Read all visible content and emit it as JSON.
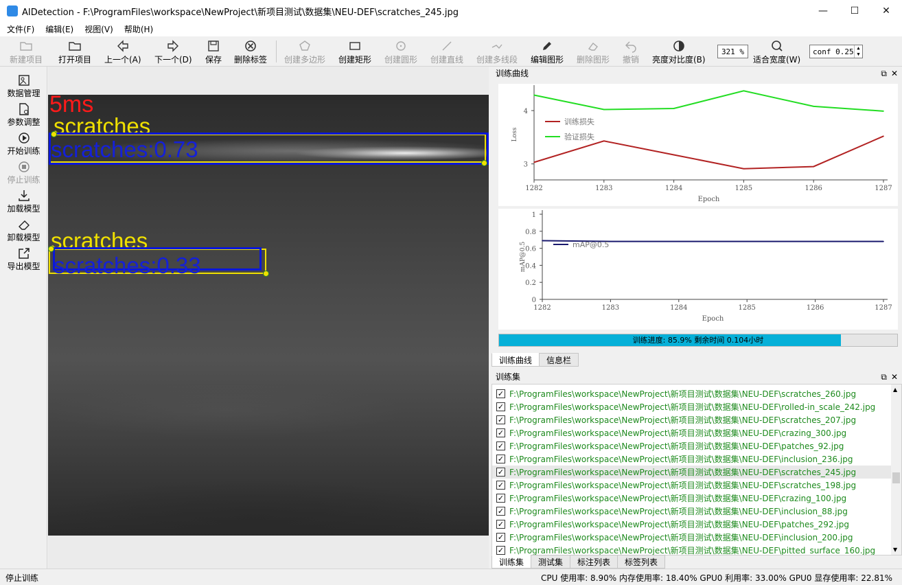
{
  "window": {
    "title": "AIDetection - F:\\ProgramFiles\\workspace\\NewProject\\新项目测试\\数据集\\NEU-DEF\\scratches_245.jpg",
    "minimize": "—",
    "maximize": "☐",
    "close": "✕"
  },
  "menu": [
    "文件(F)",
    "编辑(E)",
    "视图(V)",
    "帮助(H)"
  ],
  "toolbar": {
    "new_project": "新建项目",
    "open_project": "打开项目",
    "prev": "上一个(A)",
    "next": "下一个(D)",
    "save": "保存",
    "delete_label": "删除标签",
    "create_polygon": "创建多边形",
    "create_rect": "创建矩形",
    "create_circle": "创建圆形",
    "create_line": "创建直线",
    "create_polyline": "创建多线段",
    "edit_shape": "编辑图形",
    "delete_shape": "删除图形",
    "undo": "撤销",
    "brightness": "亮度对比度(B)",
    "zoom": "321 %",
    "fit_width": "适合宽度(W)",
    "conf": "conf 0.25"
  },
  "left_panel": {
    "data_mgmt": "数据管理",
    "params": "参数调整",
    "start_train": "开始训练",
    "stop_train": "停止训练",
    "load_model": "加载模型",
    "unload_model": "卸载模型",
    "export_model": "导出模型"
  },
  "canvas": {
    "time_label": "5ms",
    "detections": [
      {
        "label": "scratches",
        "score_label": "scratches:0.73"
      },
      {
        "label": "scratches",
        "score_label": "scratches:0.33"
      }
    ]
  },
  "curve_dock": {
    "title": "训练曲线",
    "float_icon": "⧉",
    "close_icon": "✕"
  },
  "chart_data": [
    {
      "type": "line",
      "x": [
        1282,
        1283,
        1284,
        1285,
        1286,
        1287
      ],
      "xlabel": "Epoch",
      "ylabel": "Loss",
      "x_ticks": [
        "1282",
        "1283",
        "1284",
        "1285",
        "1286",
        "1287"
      ],
      "y_ticks": [
        "3",
        "4"
      ],
      "ylim": [
        2.7,
        4.4
      ],
      "series": [
        {
          "name": "训练损失",
          "color": "#b22222",
          "values": [
            3.03,
            3.43,
            3.17,
            2.91,
            2.95,
            3.52
          ]
        },
        {
          "name": "验证损失",
          "color": "#22dd22",
          "values": [
            4.29,
            4.02,
            4.04,
            4.37,
            4.08,
            3.99
          ]
        }
      ],
      "legend": "top-left",
      "grid": false
    },
    {
      "type": "line",
      "x": [
        1282,
        1283,
        1284,
        1285,
        1286,
        1287
      ],
      "xlabel": "Epoch",
      "ylabel": "mAP@0.5",
      "x_ticks": [
        "1282",
        "1283",
        "1284",
        "1285",
        "1286",
        "1287"
      ],
      "y_ticks": [
        "0",
        "0.2",
        "0.4",
        "0.6",
        "0.8",
        "1"
      ],
      "ylim": [
        0,
        1
      ],
      "series": [
        {
          "name": "mAP@0.5",
          "color": "#1a1a6e",
          "values": [
            0.69,
            0.68,
            0.68,
            0.68,
            0.68,
            0.68
          ]
        }
      ],
      "legend": "top-left",
      "grid": false
    }
  ],
  "progress": {
    "text": "训练进度: 85.9% 剩余时间 0.104小时",
    "fraction": 0.859
  },
  "curve_tabs": [
    "训练曲线",
    "信息栏"
  ],
  "train_dock": {
    "title": "训练集",
    "float_icon": "⧉",
    "close_icon": "✕",
    "files": [
      "F:\\ProgramFiles\\workspace\\NewProject\\新项目测试\\数据集\\NEU-DEF\\scratches_260.jpg",
      "F:\\ProgramFiles\\workspace\\NewProject\\新项目测试\\数据集\\NEU-DEF\\rolled-in_scale_242.jpg",
      "F:\\ProgramFiles\\workspace\\NewProject\\新项目测试\\数据集\\NEU-DEF\\scratches_207.jpg",
      "F:\\ProgramFiles\\workspace\\NewProject\\新项目测试\\数据集\\NEU-DEF\\crazing_300.jpg",
      "F:\\ProgramFiles\\workspace\\NewProject\\新项目测试\\数据集\\NEU-DEF\\patches_92.jpg",
      "F:\\ProgramFiles\\workspace\\NewProject\\新项目测试\\数据集\\NEU-DEF\\inclusion_236.jpg",
      "F:\\ProgramFiles\\workspace\\NewProject\\新项目测试\\数据集\\NEU-DEF\\scratches_245.jpg",
      "F:\\ProgramFiles\\workspace\\NewProject\\新项目测试\\数据集\\NEU-DEF\\scratches_198.jpg",
      "F:\\ProgramFiles\\workspace\\NewProject\\新项目测试\\数据集\\NEU-DEF\\crazing_100.jpg",
      "F:\\ProgramFiles\\workspace\\NewProject\\新项目测试\\数据集\\NEU-DEF\\inclusion_88.jpg",
      "F:\\ProgramFiles\\workspace\\NewProject\\新项目测试\\数据集\\NEU-DEF\\patches_292.jpg",
      "F:\\ProgramFiles\\workspace\\NewProject\\新项目测试\\数据集\\NEU-DEF\\inclusion_200.jpg",
      "F:\\ProgramFiles\\workspace\\NewProject\\新项目测试\\数据集\\NEU-DEF\\pitted_surface_160.jpg"
    ],
    "selected_index": 6
  },
  "list_tabs": [
    "训练集",
    "测试集",
    "标注列表",
    "标签列表"
  ],
  "status": {
    "left": "停止训练",
    "right": "CPU 使用率: 8.90% 内存使用率: 18.40% GPU0 利用率: 33.00% GPU0 显存使用率: 22.81%"
  }
}
